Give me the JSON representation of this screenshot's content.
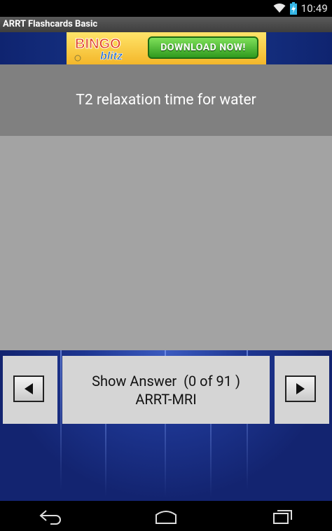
{
  "status_bar": {
    "time": "10:49",
    "icons": [
      "wifi-icon",
      "battery-charging-icon"
    ]
  },
  "app": {
    "title": "ARRT Flashcards Basic"
  },
  "ad": {
    "logo_text_top": "BINGO",
    "logo_text_bottom": "blitz",
    "button_label": "DOWNLOAD NOW!"
  },
  "card": {
    "question": "T2 relaxation time for water"
  },
  "controls": {
    "prev_icon": "left-arrow-icon",
    "next_icon": "right-arrow-icon",
    "show_answer_label": "Show Answer  (0 of 91 )",
    "deck_name": "ARRT-MRI"
  },
  "navigation_bar": {
    "icons": [
      "back-icon",
      "home-icon",
      "recent-apps-icon"
    ]
  },
  "colors": {
    "card_top": "#808080",
    "card_body": "#a3a3a3",
    "background_blue": "#1d3590",
    "button_gray": "#d5d5d5"
  }
}
